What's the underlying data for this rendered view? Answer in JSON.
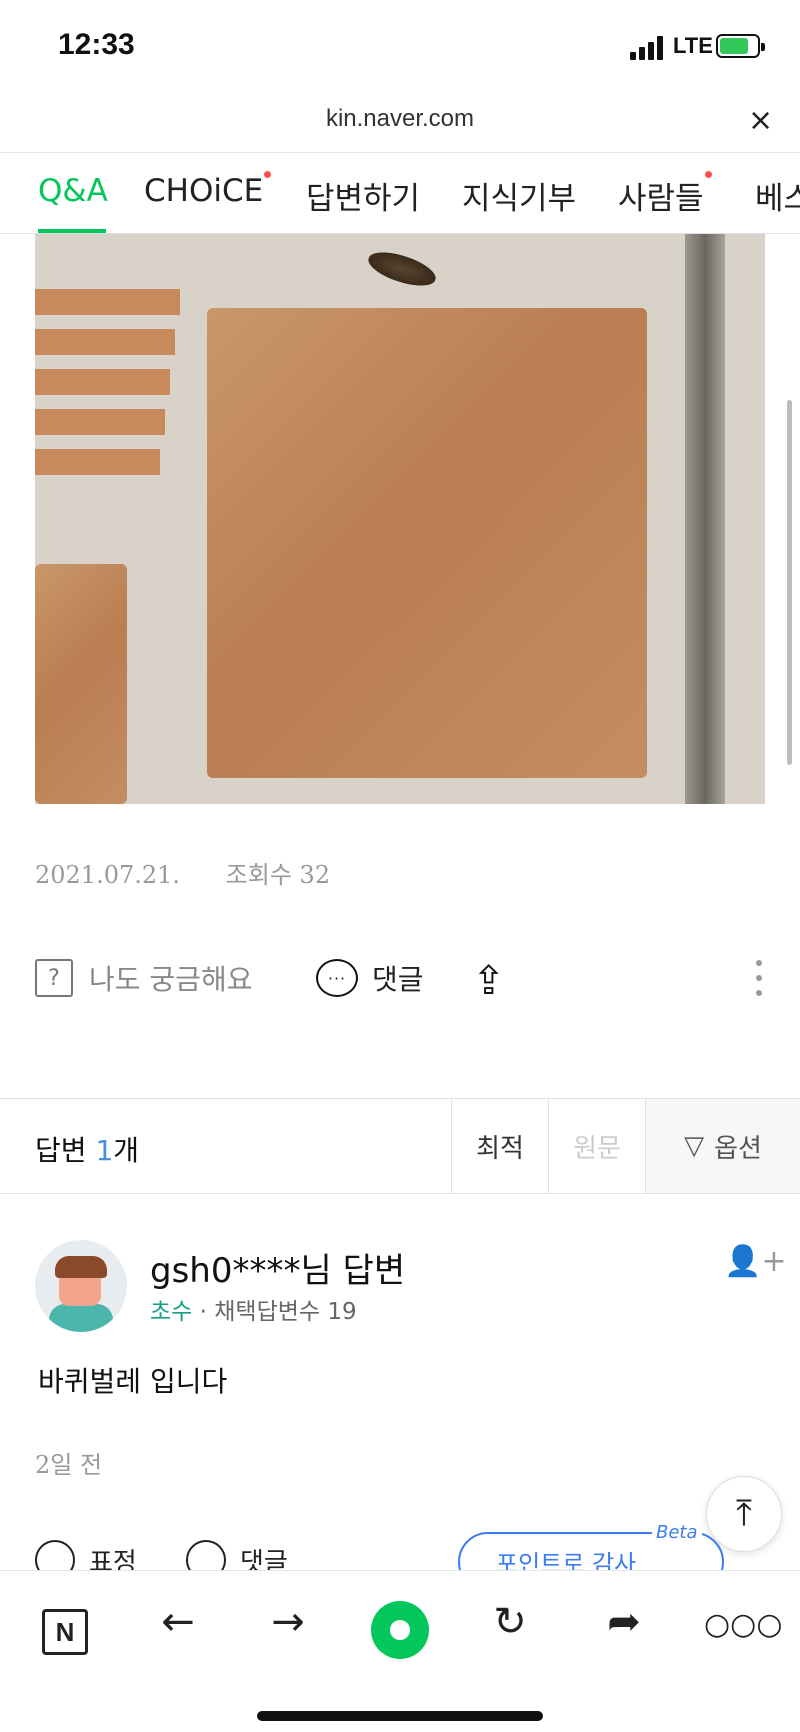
{
  "status_bar": {
    "time": "12:33",
    "network": "LTE"
  },
  "url_bar": {
    "url": "kin.naver.com",
    "close_symbol": "×"
  },
  "tabs": [
    {
      "label": "Q&A",
      "active": true,
      "dot": false
    },
    {
      "label": "CHOiCE",
      "active": false,
      "dot": true
    },
    {
      "label": "답변하기",
      "active": false,
      "dot": false
    },
    {
      "label": "지식기부",
      "active": false,
      "dot": false
    },
    {
      "label": "사람들",
      "active": false,
      "dot": true
    },
    {
      "label": "베스",
      "active": false,
      "dot": false
    }
  ],
  "question": {
    "date": "2021.07.21.",
    "views": "조회수 32",
    "actions": {
      "curious": "나도 궁금해요",
      "comment": "댓글"
    }
  },
  "answers_header": {
    "label": "답변",
    "count": "1",
    "unit": "개",
    "sort": {
      "best": "최적",
      "original": "원문",
      "option": "옵션"
    }
  },
  "answer": {
    "author": "gsh0****님 답변",
    "level": "초수",
    "adopted": "· 채택답변수 19",
    "text": "바퀴벌레 입니다",
    "ago": "2일 전"
  },
  "partial_row": {
    "emotion": "표정",
    "comment": "댓글",
    "point_button": "포인트로 감사",
    "beta": "Beta"
  },
  "toolbar": {
    "n_label": "N"
  },
  "colors": {
    "accent_green": "#03c75a",
    "link_blue": "#3d7cf0",
    "count_blue": "#4a90e2"
  }
}
